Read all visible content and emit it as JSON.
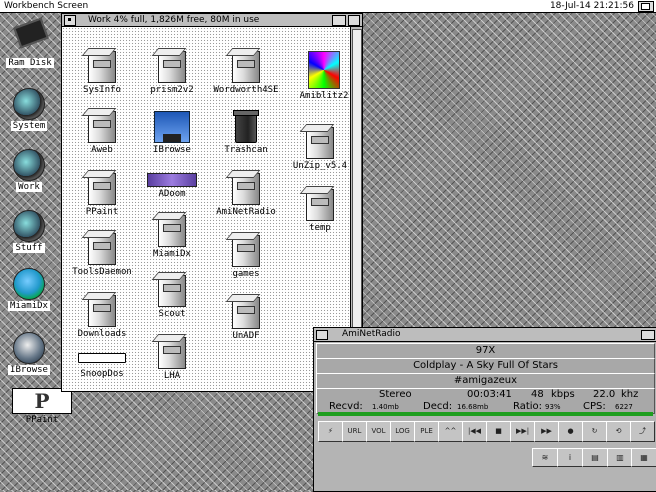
{
  "screen": {
    "title": "Workbench Screen",
    "clock": "18-Jul-14 21:21:56"
  },
  "desktop_icons": [
    {
      "label": "Ram Disk"
    },
    {
      "label": "System"
    },
    {
      "label": "Work"
    },
    {
      "label": "Stuff"
    },
    {
      "label": "MiamiDx"
    },
    {
      "label": "IBrowse"
    },
    {
      "label": "PPaint"
    }
  ],
  "work_window": {
    "title": "Work  4% full, 1,826M free, 80M in use",
    "icons": [
      {
        "label": "SysInfo",
        "icon": "drawer-icon"
      },
      {
        "label": "prism2v2",
        "icon": "drawer-icon"
      },
      {
        "label": "Wordworth4SE",
        "icon": "drawer-icon"
      },
      {
        "label": "Amiblitz2",
        "icon": "amiblitz-icon"
      },
      {
        "label": "Aweb",
        "icon": "drawer-icon"
      },
      {
        "label": "IBrowse",
        "icon": "ibrowse-icon"
      },
      {
        "label": "Trashcan",
        "icon": "trashcan-icon"
      },
      {
        "label": "UnZip_v5.4",
        "icon": "drawer-icon"
      },
      {
        "label": "PPaint",
        "icon": "drawer-icon"
      },
      {
        "label": "ADoom",
        "icon": "adoom-icon"
      },
      {
        "label": "AmiNetRadio",
        "icon": "drawer-icon"
      },
      {
        "label": "temp",
        "icon": "drawer-icon"
      },
      {
        "label": "ToolsDaemon",
        "icon": "drawer-icon"
      },
      {
        "label": "MiamiDx",
        "icon": "drawer-icon"
      },
      {
        "label": "games",
        "icon": "drawer-icon"
      },
      {
        "label": "Downloads",
        "icon": "drawer-icon"
      },
      {
        "label": "Scout",
        "icon": "drawer-icon"
      },
      {
        "label": "UnADF",
        "icon": "drawer-icon"
      },
      {
        "label": "SnoopDos",
        "icon": "snoopdos-icon"
      },
      {
        "label": "LHA",
        "icon": "drawer-icon"
      }
    ]
  },
  "radio": {
    "title": "AmiNetRadio",
    "station": "97X",
    "track": "Coldplay - A Sky Full Of Stars",
    "channel": "#amigazeux",
    "mode": "Stereo",
    "time": "00:03:41",
    "bitrate_value": "48",
    "bitrate_unit": "kbps",
    "freq_value": "22.0",
    "freq_unit": "khz",
    "recvd_label": "Recvd:",
    "recvd_value": "1.40mb",
    "decd_label": "Decd:",
    "decd_value": "16.68mb",
    "ratio_label": "Ratio:",
    "ratio_value": "93%",
    "cps_label": "CPS:",
    "cps_value": "6227",
    "buttons": [
      "⚡",
      "URL",
      "VOL",
      "LOG",
      "PLE",
      "^^",
      "|◀◀",
      "■",
      "▶▶|",
      "▶▶",
      "●",
      "↻",
      "⟲",
      "⤴"
    ],
    "small_buttons": [
      "≋",
      "i",
      "▤",
      "▥",
      "▦"
    ]
  }
}
